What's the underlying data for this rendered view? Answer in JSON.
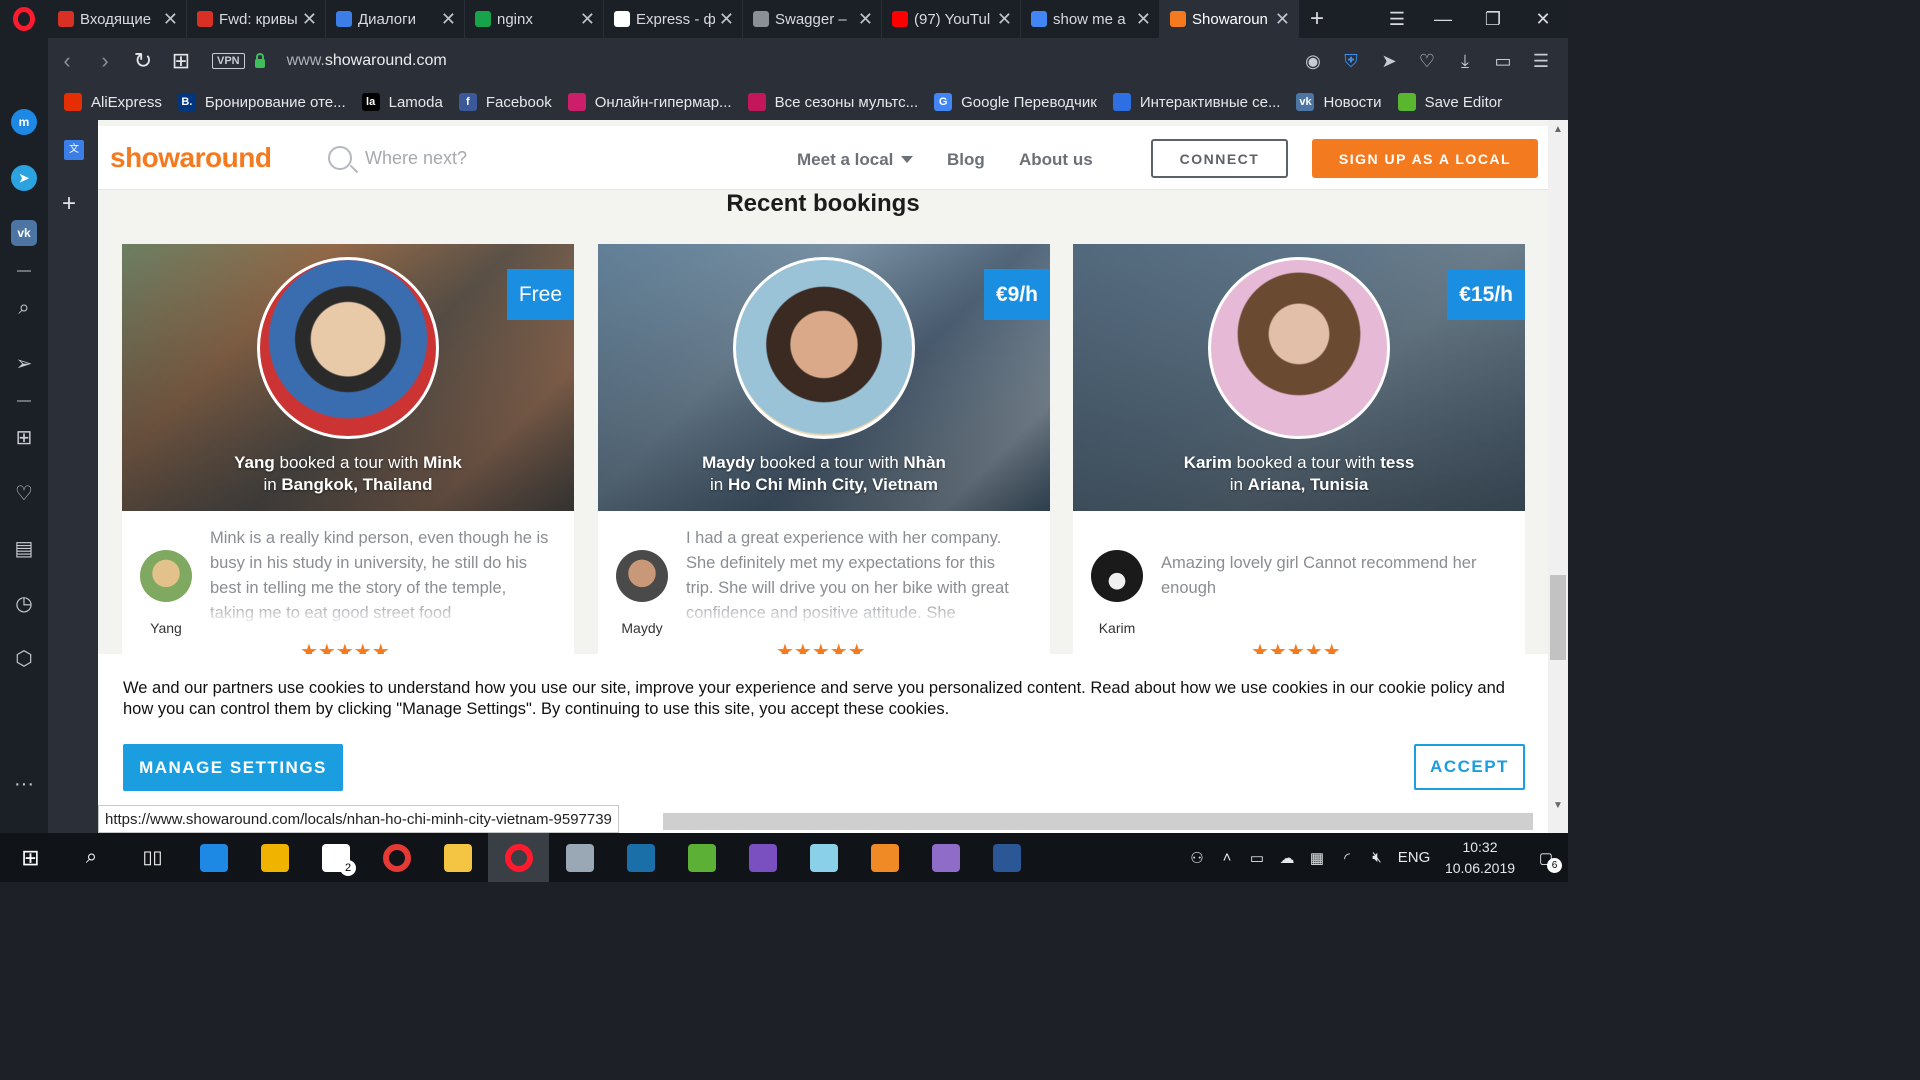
{
  "tabs": [
    {
      "label": "Входящие",
      "icon": "gmail-icon",
      "color": "#d93025"
    },
    {
      "label": "Fwd: кривы",
      "icon": "gmail-icon",
      "color": "#d93025"
    },
    {
      "label": "Диалоги",
      "icon": "chat-icon",
      "color": "#3c7ee8"
    },
    {
      "label": "nginx",
      "icon": "nginx-icon",
      "color": "#16a34a"
    },
    {
      "label": "Express - ф",
      "icon": "express-icon",
      "color": "#ffffff"
    },
    {
      "label": "Swagger –",
      "icon": "loading-icon",
      "color": "#8a8f98"
    },
    {
      "label": "(97) YouTul",
      "icon": "youtube-icon",
      "color": "#ff0000"
    },
    {
      "label": "show me a",
      "icon": "google-icon",
      "color": "#4285f4"
    },
    {
      "label": "Showaroun",
      "icon": "showaround-icon",
      "color": "#f47a20",
      "active": true
    }
  ],
  "address": {
    "vpn": "VPN",
    "url_prefix": "www.",
    "url_domain": "showaround.com"
  },
  "bookmarks": [
    {
      "label": "AliExpress",
      "color": "#e62e04",
      "glyph": ""
    },
    {
      "label": "Бронирование оте...",
      "color": "#003580",
      "glyph": "B."
    },
    {
      "label": "Lamoda",
      "color": "#000000",
      "glyph": "la"
    },
    {
      "label": "Facebook",
      "color": "#3b5998",
      "glyph": "f"
    },
    {
      "label": "Онлайн-гипермар...",
      "color": "#cc1e6b",
      "glyph": ""
    },
    {
      "label": "Все сезоны мультс...",
      "color": "#c2185b",
      "glyph": ""
    },
    {
      "label": "Google Переводчик",
      "color": "#4285f4",
      "glyph": "G"
    },
    {
      "label": "Интерактивные се...",
      "color": "#2f6fe4",
      "glyph": ""
    },
    {
      "label": "Новости",
      "color": "#4c75a3",
      "glyph": "vk"
    },
    {
      "label": "Save Editor",
      "color": "#5ab52f",
      "glyph": ""
    }
  ],
  "site": {
    "logo": "showaround",
    "search_placeholder": "Where next?",
    "nav": {
      "meet": "Meet a local",
      "blog": "Blog",
      "about": "About us"
    },
    "connect": "CONNECT",
    "signup": "SIGN UP AS A LOCAL",
    "section_title": "Recent bookings"
  },
  "cards": [
    {
      "price": "Free",
      "traveler": "Yang",
      "local": "Mink",
      "location": "Bangkok, Thailand",
      "review": "Mink is a really kind person, even though he is busy in his study in university, he still do his best in telling me the story of the temple, taking me to eat good street food",
      "stars": "★★★★★"
    },
    {
      "price": "€9/h",
      "traveler": "Maydy",
      "local": "Nhàn",
      "location": "Ho Chi Minh City, Vietnam",
      "review": "I had a great experience with her company. She definitely met my expectations for this trip. She will drive you on her bike with great confidence and positive attitude. She",
      "stars": "★★★★★"
    },
    {
      "price": "€15/h",
      "traveler": "Karim",
      "local": "tess",
      "location": "Ariana, Tunisia",
      "review": "Amazing lovely girl Cannot recommend her enough",
      "stars": "★★★★★"
    }
  ],
  "booked_word": "booked a tour with",
  "in_word": "in",
  "cookie": {
    "text": "We and our partners use cookies to understand how you use our site, improve your experience and serve you personalized content. Read about how we use cookies in our cookie policy and how you can control them by clicking \"Manage Settings\". By continuing to use this site, you accept these cookies.",
    "manage": "MANAGE SETTINGS",
    "accept": "ACCEPT"
  },
  "status_url": "https://www.showaround.com/locals/nhan-ho-chi-minh-city-vietnam-9597739",
  "taskbar": {
    "apps": [
      {
        "name": "windows-start",
        "color": "#ffffff"
      },
      {
        "name": "search",
        "color": "#ffffff"
      },
      {
        "name": "task-view",
        "color": "#ffffff"
      },
      {
        "name": "edge",
        "color": "#1e88e5"
      },
      {
        "name": "store",
        "color": "#f0b400"
      },
      {
        "name": "mail",
        "color": "#ffffff",
        "badge": "2"
      },
      {
        "name": "chrome",
        "color": "#e53935"
      },
      {
        "name": "explorer",
        "color": "#f4c542"
      },
      {
        "name": "opera",
        "color": "#ff1b2d",
        "active": true
      },
      {
        "name": "network-app",
        "color": "#9aa7b5"
      },
      {
        "name": "steam",
        "color": "#1b6fa8"
      },
      {
        "name": "utorrent",
        "color": "#5cb035"
      },
      {
        "name": "visual-studio",
        "color": "#7a4fbf"
      },
      {
        "name": "notes",
        "color": "#8ad0e8"
      },
      {
        "name": "sublime",
        "color": "#f08a24"
      },
      {
        "name": "github",
        "color": "#8e6cc8"
      },
      {
        "name": "word",
        "color": "#2b5797"
      }
    ],
    "lang": "ENG",
    "time": "10:32",
    "date": "10.06.2019",
    "notif_count": "6"
  }
}
